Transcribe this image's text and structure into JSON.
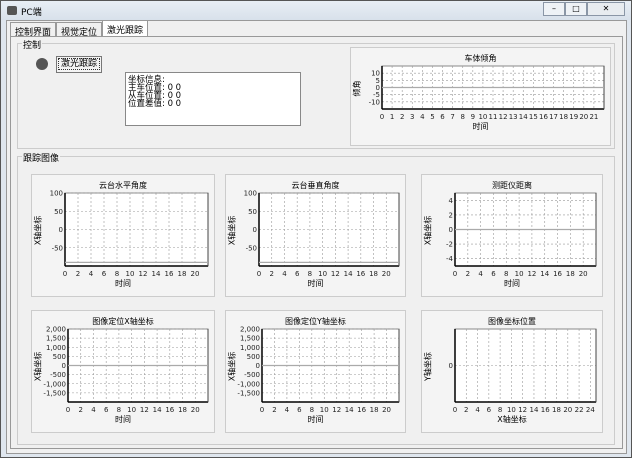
{
  "window": {
    "title": "PC端",
    "minimize": "–",
    "maximize": "□",
    "close": "✕"
  },
  "tabs": [
    {
      "label": "控制界面"
    },
    {
      "label": "视觉定位"
    },
    {
      "label": "激光跟踪",
      "active": true
    }
  ],
  "control": {
    "group_label": "控制",
    "status_color": "#555555",
    "button_label": "激光跟踪",
    "info_lines": [
      "坐标信息:",
      "主车位置:  0   0",
      "从车位置:  0   0",
      "位置差值:  0   0"
    ]
  },
  "tracking": {
    "group_label": "跟踪图像"
  },
  "chart_data": [
    {
      "id": "tilt",
      "type": "line",
      "title": "车体倾角",
      "xlabel": "时间",
      "ylabel": "倾角",
      "xlim": [
        0,
        22
      ],
      "ylim": [
        -15,
        15
      ],
      "xticks": [
        0,
        1,
        2,
        3,
        4,
        5,
        6,
        7,
        8,
        9,
        10,
        11,
        12,
        13,
        14,
        15,
        16,
        17,
        18,
        19,
        20,
        21
      ],
      "yticks": [
        10,
        5,
        0,
        -5,
        -10
      ],
      "ytick_labels": [
        "10",
        "5",
        "0",
        "-5",
        "-10"
      ],
      "grid": true,
      "series": [
        {
          "name": "倾角",
          "x": [
            0,
            22
          ],
          "y": [
            0,
            0
          ]
        }
      ]
    },
    {
      "id": "pan",
      "type": "line",
      "title": "云台水平角度",
      "xlabel": "时间",
      "ylabel": "X轴坐标",
      "xlim": [
        0,
        22
      ],
      "ylim": [
        -100,
        100
      ],
      "xticks": [
        0,
        2,
        4,
        6,
        8,
        10,
        12,
        14,
        16,
        18,
        20
      ],
      "yticks": [
        100,
        50,
        0,
        -50
      ],
      "ytick_labels": [
        "100",
        "50",
        "0",
        "-50"
      ],
      "grid": true,
      "series": [
        {
          "name": "水平角度",
          "x": [
            0,
            22
          ],
          "y": [
            -90,
            -90
          ]
        }
      ]
    },
    {
      "id": "tiltcam",
      "type": "line",
      "title": "云台垂直角度",
      "xlabel": "时间",
      "ylabel": "X轴坐标",
      "xlim": [
        0,
        22
      ],
      "ylim": [
        -100,
        100
      ],
      "xticks": [
        0,
        2,
        4,
        6,
        8,
        10,
        12,
        14,
        16,
        18,
        20
      ],
      "yticks": [
        100,
        50,
        0,
        -50
      ],
      "ytick_labels": [
        "100",
        "50",
        "0",
        "-50"
      ],
      "grid": true,
      "series": [
        {
          "name": "垂直角度",
          "x": [
            0,
            22
          ],
          "y": [
            -90,
            -90
          ]
        }
      ]
    },
    {
      "id": "range",
      "type": "line",
      "title": "测距仪距离",
      "xlabel": "时间",
      "ylabel": "X轴坐标",
      "xlim": [
        0,
        22
      ],
      "ylim": [
        -5,
        5
      ],
      "xticks": [
        0,
        2,
        4,
        6,
        8,
        10,
        12,
        14,
        16,
        18,
        20
      ],
      "yticks": [
        4,
        2,
        0,
        -2,
        -4
      ],
      "ytick_labels": [
        "4",
        "2",
        "0",
        "-2",
        "-4"
      ],
      "grid": true,
      "series": [
        {
          "name": "距离",
          "x": [
            0,
            22
          ],
          "y": [
            0,
            0
          ]
        }
      ]
    },
    {
      "id": "imgx",
      "type": "line",
      "title": "图像定位X轴坐标",
      "xlabel": "时间",
      "ylabel": "X轴坐标",
      "xlim": [
        0,
        22
      ],
      "ylim": [
        -2000,
        2000
      ],
      "xticks": [
        0,
        2,
        4,
        6,
        8,
        10,
        12,
        14,
        16,
        18,
        20
      ],
      "yticks": [
        2000,
        1500,
        1000,
        500,
        0,
        -500,
        -1000,
        -1500
      ],
      "ytick_labels": [
        "2,000",
        "1,500",
        "1,000",
        "500",
        "0",
        "-500",
        "-1,000",
        "-1,500"
      ],
      "grid": true,
      "series": [
        {
          "name": "X",
          "x": [
            0,
            22
          ],
          "y": [
            0,
            0
          ]
        }
      ]
    },
    {
      "id": "imgy",
      "type": "line",
      "title": "图像定位Y轴坐标",
      "xlabel": "时间",
      "ylabel": "X轴坐标",
      "xlim": [
        0,
        22
      ],
      "ylim": [
        -2000,
        2000
      ],
      "xticks": [
        0,
        2,
        4,
        6,
        8,
        10,
        12,
        14,
        16,
        18,
        20
      ],
      "yticks": [
        2000,
        1500,
        1000,
        500,
        0,
        -500,
        -1000,
        -1500
      ],
      "ytick_labels": [
        "2,000",
        "1,500",
        "1,000",
        "500",
        "0",
        "-500",
        "-1,000",
        "-1,500"
      ],
      "grid": true,
      "series": [
        {
          "name": "Y",
          "x": [
            0,
            22
          ],
          "y": [
            0,
            0
          ]
        }
      ]
    },
    {
      "id": "imgpos",
      "type": "scatter",
      "title": "图像坐标位置",
      "xlabel": "X轴坐标",
      "ylabel": "Y轴坐标",
      "xlim": [
        0,
        25
      ],
      "ylim": [
        -1,
        1
      ],
      "xticks": [
        0,
        2,
        4,
        6,
        8,
        10,
        12,
        14,
        16,
        18,
        20,
        22,
        24
      ],
      "yticks": [
        0
      ],
      "ytick_labels": [
        "0"
      ],
      "grid": true,
      "series": []
    }
  ]
}
